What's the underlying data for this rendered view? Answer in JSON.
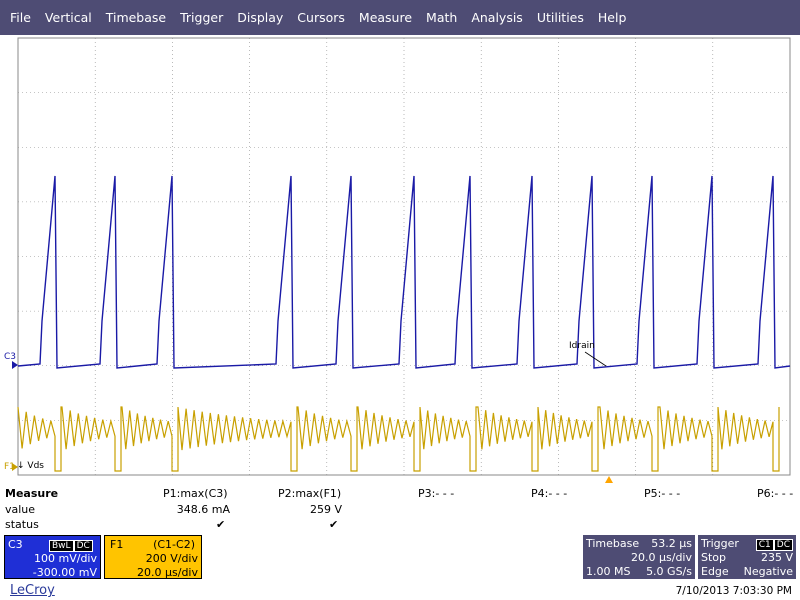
{
  "menu": [
    "File",
    "Vertical",
    "Timebase",
    "Trigger",
    "Display",
    "Cursors",
    "Measure",
    "Math",
    "Analysis",
    "Utilities",
    "Help"
  ],
  "trace_labels": {
    "c3": "C3",
    "f1": "F1",
    "vds": "Vds",
    "idrain": "Idrain"
  },
  "colors": {
    "menu_bg": "#4e4c74",
    "c3": "#1a1aa6",
    "f1": "#c8a000",
    "grid": "#8c8c8c"
  },
  "measure": {
    "title": "Measure",
    "row_value": "value",
    "row_status": "status",
    "params": [
      {
        "label": "P1:max(C3)",
        "value": "348.6 mA",
        "status": "✔"
      },
      {
        "label": "P2:max(F1)",
        "value": "259 V",
        "status": "✔"
      },
      {
        "label": "P3:- - -",
        "value": "",
        "status": ""
      },
      {
        "label": "P4:- - -",
        "value": "",
        "status": ""
      },
      {
        "label": "P5:- - -",
        "value": "",
        "status": ""
      },
      {
        "label": "P6:- - -",
        "value": "",
        "status": ""
      }
    ]
  },
  "c3_box": {
    "name": "C3",
    "tags": [
      "BwL",
      "DC"
    ],
    "scale": "100 mV/div",
    "offset": "-300.00 mV"
  },
  "f1_box": {
    "name": "F1",
    "expr": "(C1-C2)",
    "scale": "200 V/div",
    "time": "20.0 µs/div"
  },
  "timebase": {
    "label": "Timebase",
    "value": "53.2 µs",
    "per_div": "20.0 µs/div",
    "samples": "1.00 MS",
    "rate": "5.0 GS/s"
  },
  "trigger": {
    "label": "Trigger",
    "source": "C1",
    "coupling": "DC",
    "mode": "Stop",
    "level": "235 V",
    "type": "Edge",
    "slope": "Negative"
  },
  "brand": "LeCroy",
  "datetime": "7/10/2013 7:03:30 PM"
}
